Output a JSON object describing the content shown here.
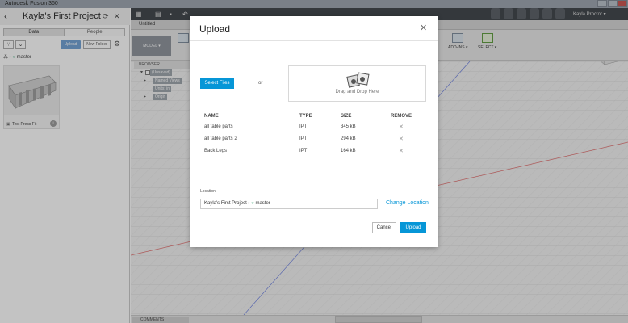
{
  "window": {
    "title": "Autodesk Fusion 360"
  },
  "data_panel": {
    "project_title": "Kayla's First Project",
    "tabs": [
      {
        "label": "Data"
      },
      {
        "label": "People"
      }
    ],
    "upload_label": "Upload",
    "new_folder_label": "New Folder",
    "breadcrumb": "master",
    "files": [
      {
        "name": "Test Press Fit"
      }
    ]
  },
  "app": {
    "user_name": "Kayla Proctor",
    "document_tab": "Untitled",
    "workspace_label": "MODEL",
    "ribbon": [
      {
        "label": "ADD-INS"
      },
      {
        "label": "SELECT"
      }
    ],
    "browser": {
      "header": "BROWSER",
      "items": [
        {
          "label": "(Unsaved)"
        },
        {
          "label": "Named Views"
        },
        {
          "label": "Units: in"
        },
        {
          "label": "Origin"
        }
      ]
    },
    "comments_label": "COMMENTS"
  },
  "dialog": {
    "title": "Upload",
    "select_files_label": "Select Files",
    "or_label": "or",
    "drop_label": "Drag and Drop Here",
    "columns": [
      "NAME",
      "TYPE",
      "SIZE",
      "REMOVE"
    ],
    "files": [
      {
        "name": "all table parts",
        "type": "IPT",
        "size": "345 kB"
      },
      {
        "name": "all table parts 2",
        "type": "IPT",
        "size": "294 kB"
      },
      {
        "name": "Back Legs",
        "type": "IPT",
        "size": "164 kB"
      }
    ],
    "location_label": "Location:",
    "location_project": "Kayla's First Project",
    "location_branch": "master",
    "change_location_label": "Change Location",
    "cancel_label": "Cancel",
    "upload_label": "Upload"
  },
  "colors": {
    "accent": "#0696d7",
    "branch": "#2a9d6a"
  }
}
